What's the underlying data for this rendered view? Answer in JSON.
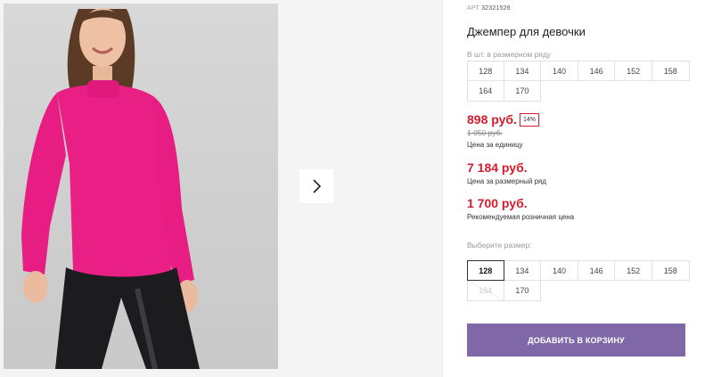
{
  "gallery": {
    "next_icon": "chevron-right-icon"
  },
  "product": {
    "art_label": "АРТ",
    "art_value": "32321526",
    "title": "Джемпер для девочки"
  },
  "size_row": {
    "label": "В шт. в размерном ряду",
    "sizes": [
      "128",
      "134",
      "140",
      "146",
      "152",
      "158",
      "164",
      "170"
    ]
  },
  "prices": {
    "unit_price": "898 руб.",
    "discount": "14%",
    "old_price": "1 050 руб.",
    "unit_caption": "Цена за единицу",
    "row_price": "7 184 руб.",
    "row_caption": "Цена за размерный ряд",
    "retail_price": "1 700 руб.",
    "retail_caption": "Рекомендуемая розничная цена"
  },
  "size_select": {
    "label": "Выберите размер:",
    "sizes": [
      "128",
      "134",
      "140",
      "146",
      "152",
      "158",
      "164",
      "170"
    ],
    "selected": "128",
    "unavailable": "164"
  },
  "cart": {
    "label": "ДОБАВИТЬ В КОРЗИНУ"
  },
  "colors": {
    "price_red": "#d61b2c",
    "cart_purple": "#7f67a8",
    "sweater_pink": "#ea1f86"
  }
}
